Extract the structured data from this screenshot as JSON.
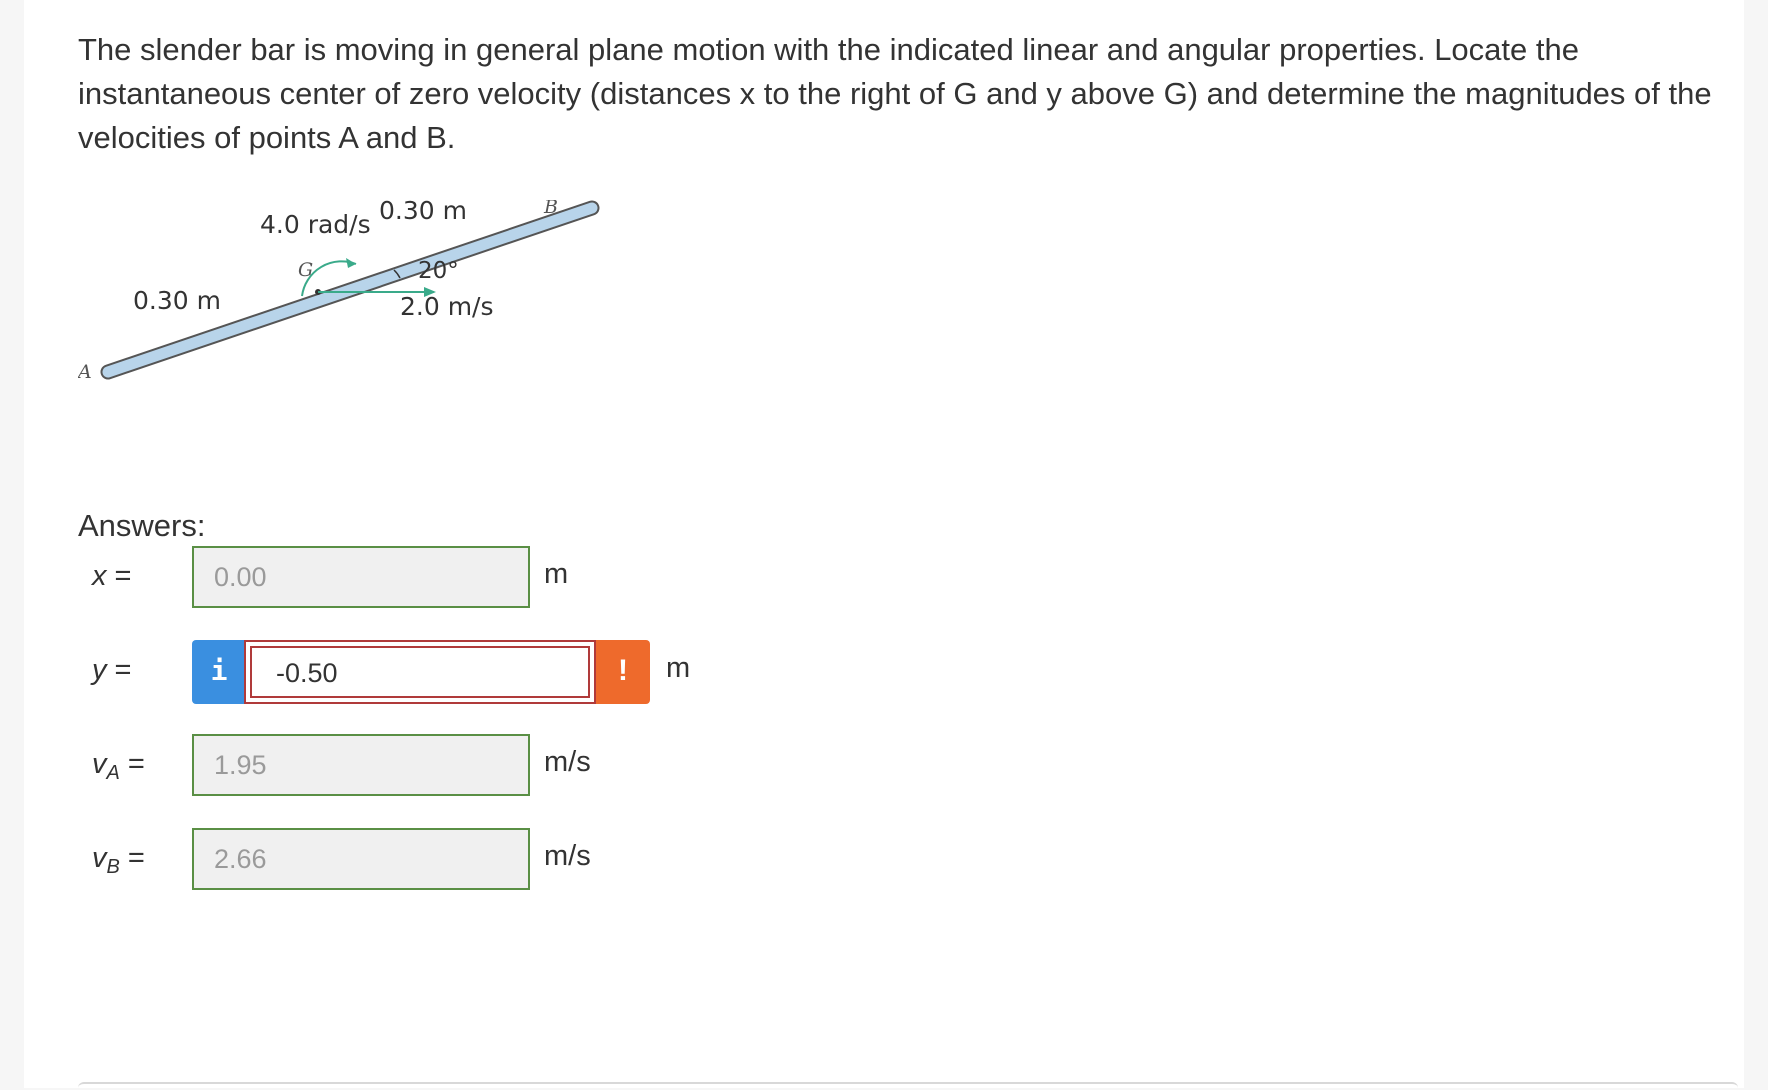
{
  "question": {
    "text": "The slender bar is moving in general plane motion with the indicated linear and angular properties. Locate the instantaneous center of zero velocity (distances x to the right of G and y above G) and determine the magnitudes of the velocities of points A and B."
  },
  "figure": {
    "omega_label": "4.0 rad/s",
    "top_length_label": "0.30 m",
    "left_length_label": "0.30 m",
    "angle_label": "20°",
    "velocity_label": "2.0 m/s",
    "point_a": "A",
    "point_b": "B",
    "point_g": "G",
    "bar_color": "#b8d4ea",
    "arrow_color": "#3aaa8a"
  },
  "answers": {
    "title": "Answers:",
    "x": {
      "label": "x",
      "eq": " =",
      "value": "0.00",
      "unit": "m"
    },
    "y": {
      "label": "y",
      "eq": " =",
      "value": "-0.50",
      "unit": "m",
      "info_icon": "i",
      "warn_icon": "!"
    },
    "va": {
      "label": "v",
      "sub": "A",
      "eq": " =",
      "value": "1.95",
      "unit": "m/s"
    },
    "vb": {
      "label": "v",
      "sub": "B",
      "eq": " =",
      "value": "2.66",
      "unit": "m/s"
    }
  },
  "colors": {
    "correct_border": "#5a8f45",
    "error_border": "#b03a3a",
    "info_button": "#3a8fe0",
    "warning_button": "#ee6a2c"
  }
}
